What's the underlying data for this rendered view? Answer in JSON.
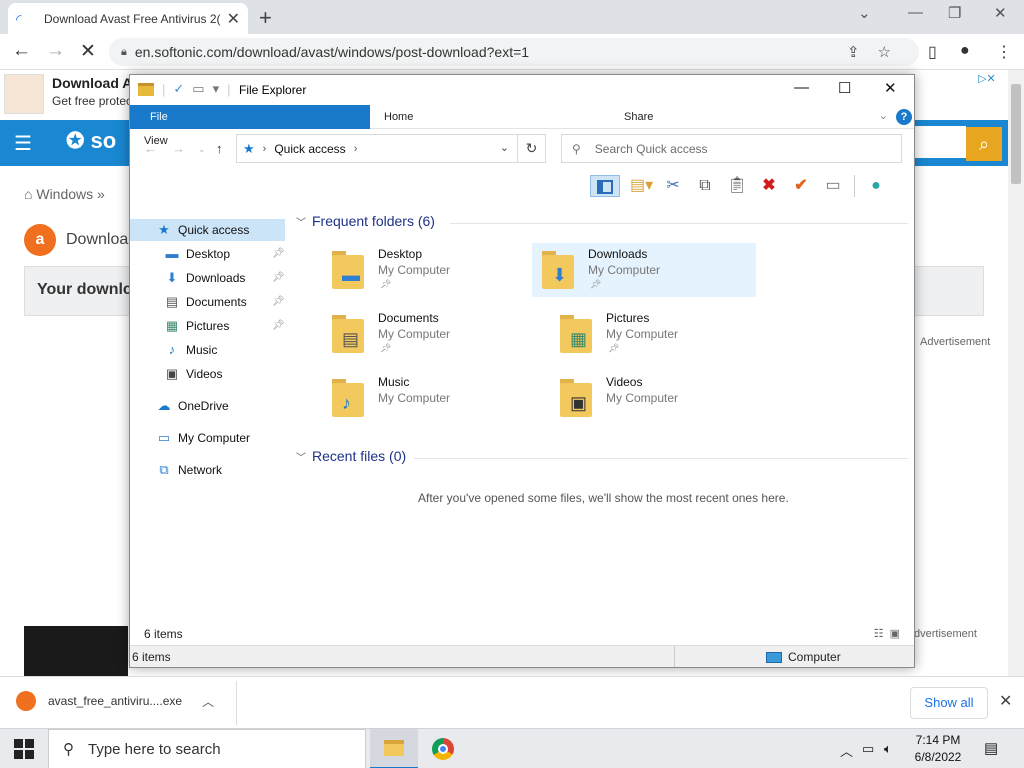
{
  "browser": {
    "tab_title": "Download Avast Free Antivirus 2(",
    "url": "en.softonic.com/download/avast/windows/post-download?ext=1",
    "new_tab_label": "+",
    "controls": {
      "minimize": "⌄",
      "restore": "❐",
      "close": "✕"
    }
  },
  "website": {
    "ad_title": "Download A",
    "ad_subtitle": "Get free protec",
    "logo_text": "so",
    "breadcrumb": "Windows »",
    "download_heading": "Downloa",
    "your_download": "Your downlc",
    "advertisement_1": "Advertisement",
    "advertisement_2": "dvertisement"
  },
  "explorer": {
    "title": "File Explorer",
    "ribbon_tabs": [
      "File",
      "Home",
      "Share",
      "View"
    ],
    "address": "Quick access",
    "search_placeholder": "Search Quick access",
    "nav": [
      {
        "label": "Quick access",
        "icon": "star-icon"
      },
      {
        "label": "Desktop",
        "icon": "desktop-icon",
        "pinned": true
      },
      {
        "label": "Downloads",
        "icon": "download-arrow-icon",
        "pinned": true
      },
      {
        "label": "Documents",
        "icon": "document-icon",
        "pinned": true
      },
      {
        "label": "Pictures",
        "icon": "picture-icon",
        "pinned": true
      },
      {
        "label": "Music",
        "icon": "music-note-icon"
      },
      {
        "label": "Videos",
        "icon": "film-icon"
      },
      {
        "label": "OneDrive",
        "icon": "cloud-icon"
      },
      {
        "label": "My Computer",
        "icon": "monitor-icon"
      },
      {
        "label": "Network",
        "icon": "network-icon"
      }
    ],
    "frequent_title": "Frequent folders (6)",
    "folders": [
      {
        "name": "Desktop",
        "location": "My Computer",
        "pinned": true,
        "glyph": "▬"
      },
      {
        "name": "Downloads",
        "location": "My Computer",
        "pinned": true,
        "glyph": "⬇"
      },
      {
        "name": "Documents",
        "location": "My Computer",
        "pinned": true,
        "glyph": "▤"
      },
      {
        "name": "Pictures",
        "location": "My Computer",
        "pinned": true,
        "glyph": "▦"
      },
      {
        "name": "Music",
        "location": "My Computer",
        "pinned": false,
        "glyph": "♪"
      },
      {
        "name": "Videos",
        "location": "My Computer",
        "pinned": false,
        "glyph": "▣"
      }
    ],
    "recent_title": "Recent files (0)",
    "recent_message": "After you've opened some files, we'll show the most recent ones here.",
    "status_count": "6 items",
    "status_bar_count": "6 items",
    "status_location": "Computer"
  },
  "download_shelf": {
    "filename": "avast_free_antiviru....exe",
    "show_all": "Show all"
  },
  "taskbar": {
    "search_placeholder": "Type here to search",
    "time": "7:14 PM",
    "date": "6/8/2022"
  }
}
